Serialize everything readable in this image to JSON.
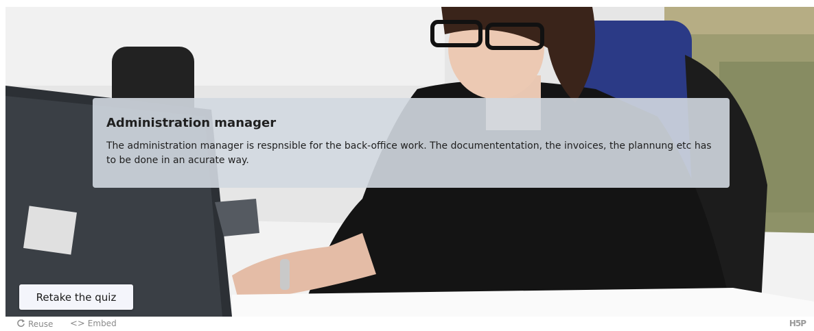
{
  "panel": {
    "title": "Administration manager",
    "text": "The administration manager is respnsible for the back-office work. The documententation, the invoices, the plannung etc has to be done in an acurate way."
  },
  "retake_button": {
    "label": "Retake the quiz"
  },
  "footer": {
    "reuse_label": "Reuse",
    "embed_label": "Embed",
    "brand": "H5P",
    "reuse_icon": "refresh-icon",
    "embed_icon": "code-icon"
  },
  "image": {
    "subject": "woman in black blazer and glasses working at an office desk with a computer monitor and keyboard"
  },
  "colors": {
    "panel_bg": "#d2d8e0",
    "button_bg": "#f4f5fb",
    "footer_text": "#8a8a8a"
  }
}
